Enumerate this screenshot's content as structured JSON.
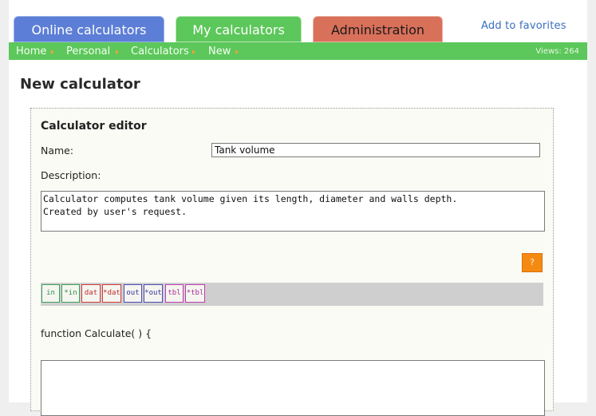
{
  "tabs": {
    "online": "Online calculators",
    "my": "My calculators",
    "admin": "Administration"
  },
  "favorites_link": "Add to favorites",
  "breadcrumb": [
    "Home",
    "Personal",
    "Calculators",
    "New"
  ],
  "views": "Views: 264",
  "page_title": "New calculator",
  "editor": {
    "title": "Calculator editor",
    "name_label": "Name:",
    "name_value": "Tank volume",
    "description_label": "Description:",
    "description_value": "Calculator computes tank volume given its length, diameter and walls depth.\nCreated by user's request.",
    "help_button": "?",
    "toolbar": [
      {
        "label": "in",
        "color": "green"
      },
      {
        "label": "*in",
        "color": "green"
      },
      {
        "label": "dat",
        "color": "red"
      },
      {
        "label": "*dat",
        "color": "red"
      },
      {
        "label": "out",
        "color": "blue"
      },
      {
        "label": "*out",
        "color": "blue"
      },
      {
        "label": "tbl",
        "color": "magenta"
      },
      {
        "label": "*tbl",
        "color": "magenta"
      }
    ],
    "function_signature": "function Calculate( ) {",
    "code_value": ""
  },
  "colors": {
    "tab_online": "#5c7ed6",
    "tab_my": "#5cc75a",
    "tab_admin": "#d9705a",
    "navbar": "#5cc75a",
    "help_button": "#f58a13"
  }
}
